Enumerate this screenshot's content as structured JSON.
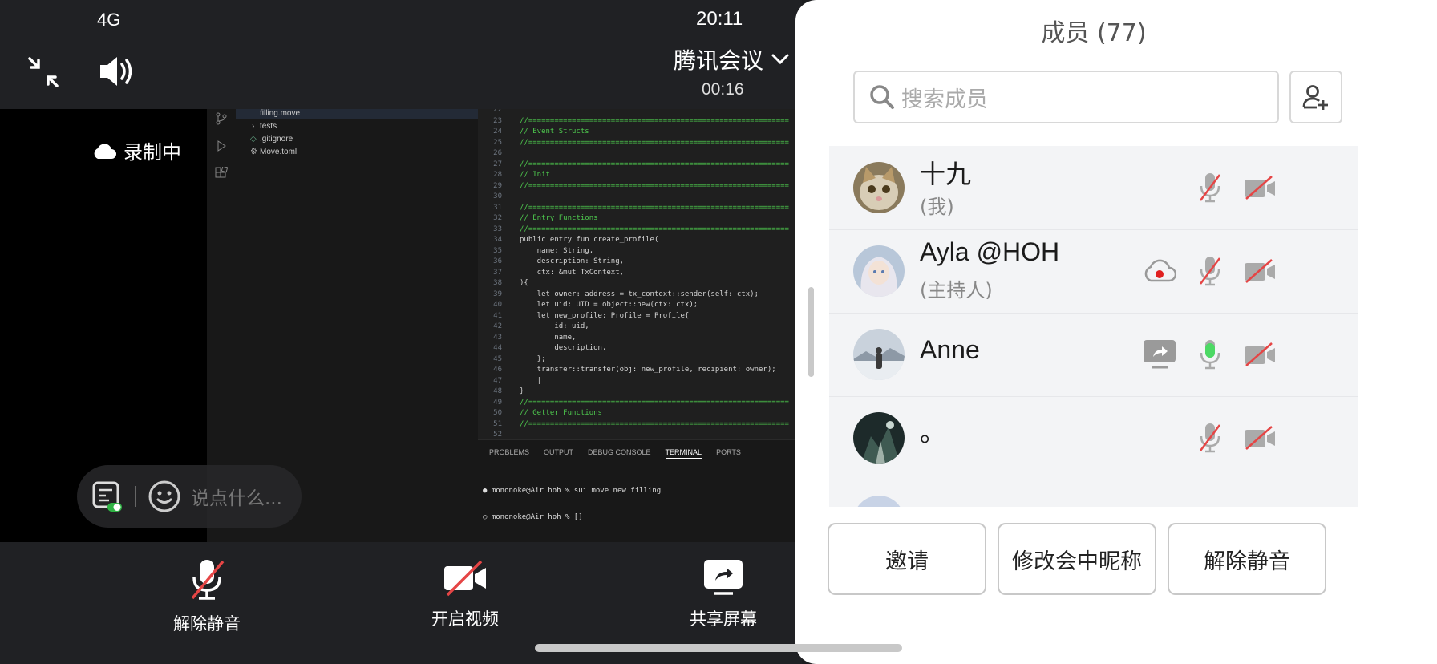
{
  "status": {
    "network": "4G",
    "time": "20:11"
  },
  "meeting": {
    "title": "腾讯会议",
    "timer": "00:16",
    "recording_label": "录制中"
  },
  "chat": {
    "placeholder": "说点什么..."
  },
  "toolbar": {
    "unmute_label": "解除静音",
    "video_label": "开启视频",
    "share_label": "共享屏幕"
  },
  "ide": {
    "explorer": [
      "filling.move",
      "tests",
      ".gitignore",
      "Move.toml"
    ],
    "code": [
      {
        "n": "22",
        "t": ""
      },
      {
        "n": "23",
        "t": "//============================================================"
      },
      {
        "n": "24",
        "t": "// Event Structs"
      },
      {
        "n": "25",
        "t": "//============================================================"
      },
      {
        "n": "26",
        "t": ""
      },
      {
        "n": "27",
        "t": "//============================================================"
      },
      {
        "n": "28",
        "t": "// Init"
      },
      {
        "n": "29",
        "t": "//============================================================"
      },
      {
        "n": "30",
        "t": ""
      },
      {
        "n": "31",
        "t": "//============================================================"
      },
      {
        "n": "32",
        "t": "// Entry Functions"
      },
      {
        "n": "33",
        "t": "//============================================================"
      },
      {
        "n": "34",
        "t": "public entry fun create_profile("
      },
      {
        "n": "35",
        "t": "    name: String,"
      },
      {
        "n": "36",
        "t": "    description: String,"
      },
      {
        "n": "37",
        "t": "    ctx: &mut TxContext,"
      },
      {
        "n": "38",
        "t": "){"
      },
      {
        "n": "39",
        "t": "    let owner: address = tx_context::sender(self: ctx);"
      },
      {
        "n": "40",
        "t": "    let uid: UID = object::new(ctx: ctx);"
      },
      {
        "n": "41",
        "t": "    let new_profile: Profile = Profile{"
      },
      {
        "n": "42",
        "t": "        id: uid,"
      },
      {
        "n": "43",
        "t": "        name,"
      },
      {
        "n": "44",
        "t": "        description,"
      },
      {
        "n": "45",
        "t": "    };"
      },
      {
        "n": "46",
        "t": "    transfer::transfer(obj: new_profile, recipient: owner);"
      },
      {
        "n": "47",
        "t": "    |"
      },
      {
        "n": "48",
        "t": "}"
      },
      {
        "n": "49",
        "t": "//============================================================"
      },
      {
        "n": "50",
        "t": "// Getter Functions"
      },
      {
        "n": "51",
        "t": "//============================================================"
      },
      {
        "n": "52",
        "t": ""
      }
    ],
    "panel_tabs": [
      "PROBLEMS",
      "OUTPUT",
      "DEBUG CONSOLE",
      "TERMINAL",
      "PORTS"
    ],
    "terminal": [
      "● mononoke@Air hoh % sui move new filling",
      "○ mononoke@Air hoh % []"
    ]
  },
  "members": {
    "title": "成员 (77)",
    "search_placeholder": "搜索成员",
    "list": [
      {
        "name": "十九",
        "role": "(我)"
      },
      {
        "name": "Ayla @HOH",
        "role": "(主持人)"
      },
      {
        "name": "Anne",
        "role": ""
      },
      {
        "name": "。",
        "role": ""
      }
    ],
    "invite_label": "邀请",
    "rename_label": "修改会中昵称",
    "unmute_label": "解除静音"
  },
  "colors": {
    "mic_active": "#4cd964",
    "muted_slash": "#e54545",
    "recording_red": "#e02020"
  }
}
